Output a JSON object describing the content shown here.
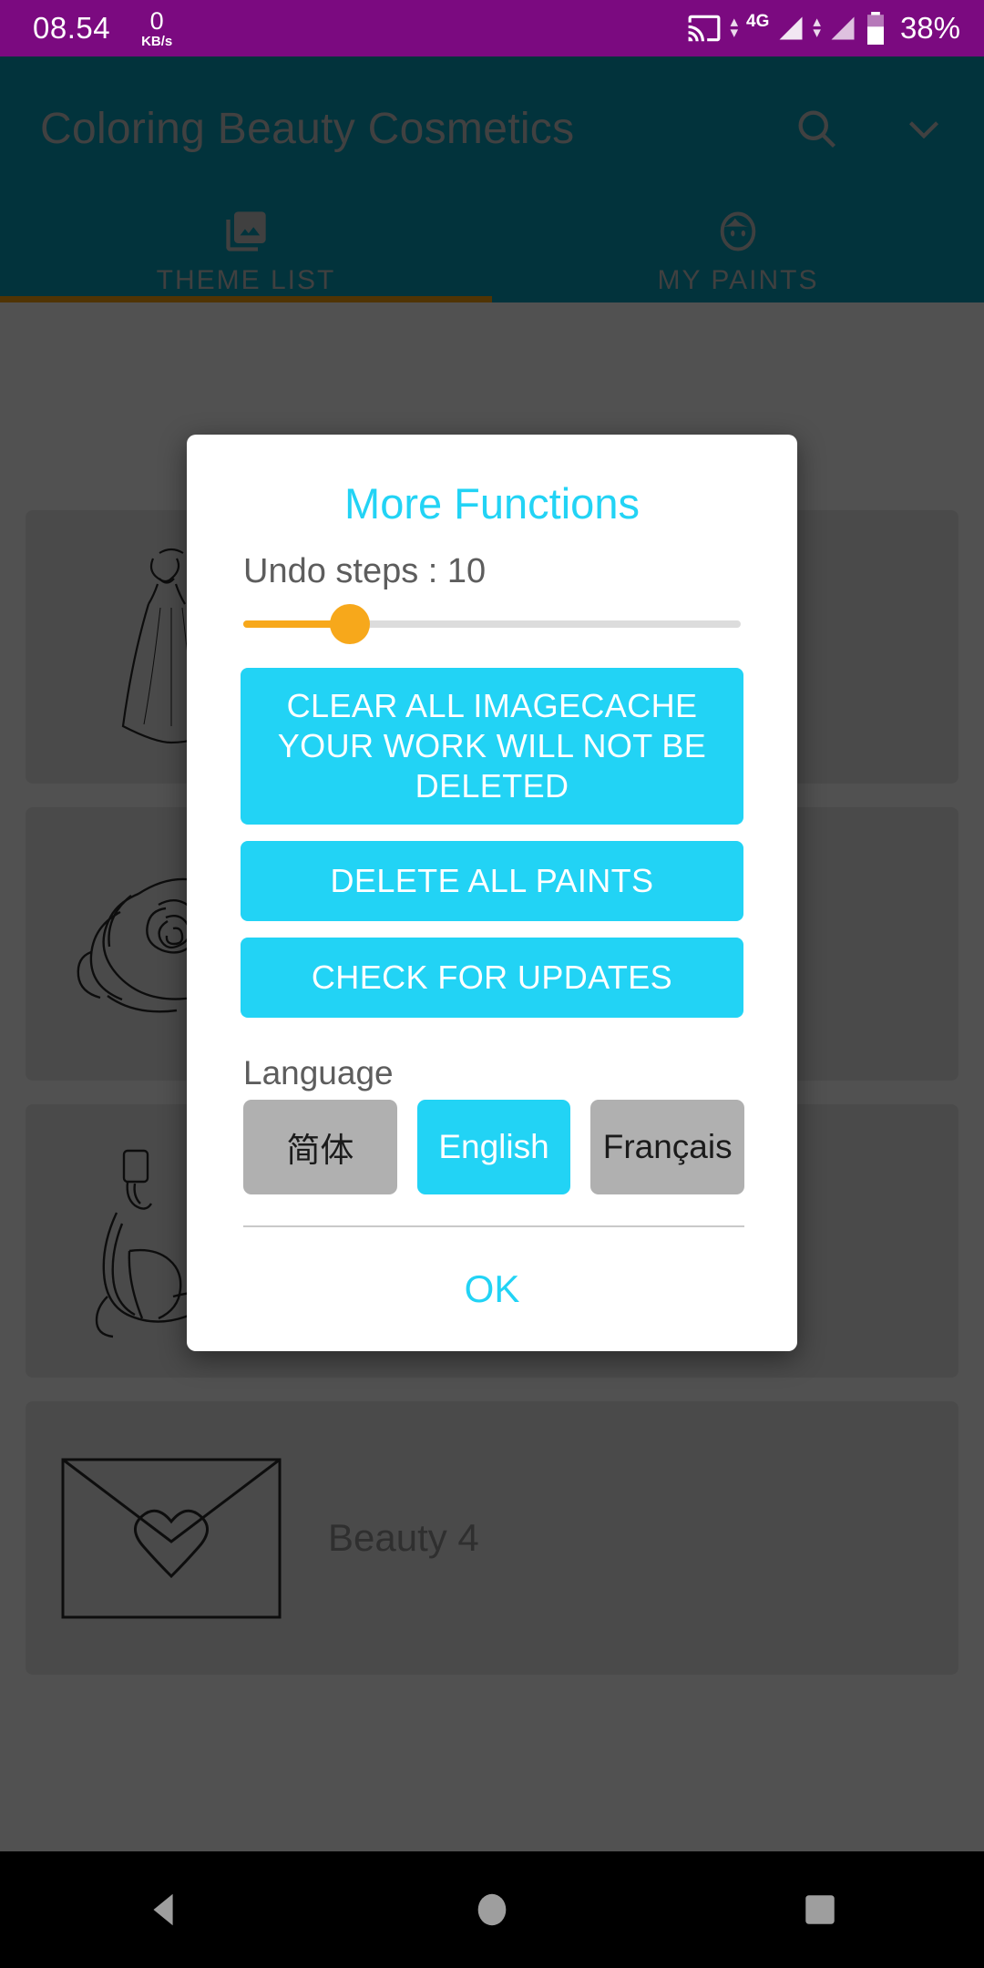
{
  "statusbar": {
    "time": "08.54",
    "net_speed_value": "0",
    "net_speed_unit": "KB/s",
    "cast_icon": "cast-icon",
    "network_type": "4G",
    "battery_percent": "38%",
    "background": "#7b0a80"
  },
  "appbar": {
    "title": "Coloring Beauty Cosmetics",
    "search_icon": "search-icon",
    "overflow_icon": "chevron-down-icon",
    "background": "#046273",
    "title_color": "#7d7d7d"
  },
  "tabs": {
    "items": [
      {
        "label": "THEME LIST",
        "icon": "photo-library-icon",
        "selected": true
      },
      {
        "label": "MY PAINTS",
        "icon": "face-icon",
        "selected": false
      }
    ],
    "indicator_color": "#9a6508"
  },
  "list": {
    "items": [
      {
        "title": "",
        "thumb": "dress-outline-icon"
      },
      {
        "title": "",
        "thumb": "rose-outline-icon"
      },
      {
        "title": "",
        "thumb": "high-heel-outline-icon"
      },
      {
        "title": "Beauty 4",
        "thumb": "envelope-heart-outline-icon"
      }
    ]
  },
  "dialog": {
    "title": "More Functions",
    "undo_label": "Undo steps : 10",
    "undo_value": 10,
    "slider_fill_percent": 20,
    "accent_color": "#22d3f5",
    "slider_color": "#f7a81b",
    "buttons": [
      {
        "id": "clear-cache",
        "label": "CLEAR ALL IMAGECACHE YOUR WORK WILL NOT BE DELETED"
      },
      {
        "id": "delete-paints",
        "label": "DELETE ALL PAINTS"
      },
      {
        "id": "check-updates",
        "label": "CHECK FOR UPDATES"
      }
    ],
    "language": {
      "label": "Language",
      "options": [
        {
          "label": "简体",
          "selected": false
        },
        {
          "label": "English",
          "selected": true
        },
        {
          "label": "Français",
          "selected": false
        }
      ]
    },
    "ok_label": "OK"
  },
  "navbar": {
    "back_icon": "back-triangle-icon",
    "home_icon": "home-circle-icon",
    "recents_icon": "recents-square-icon"
  }
}
